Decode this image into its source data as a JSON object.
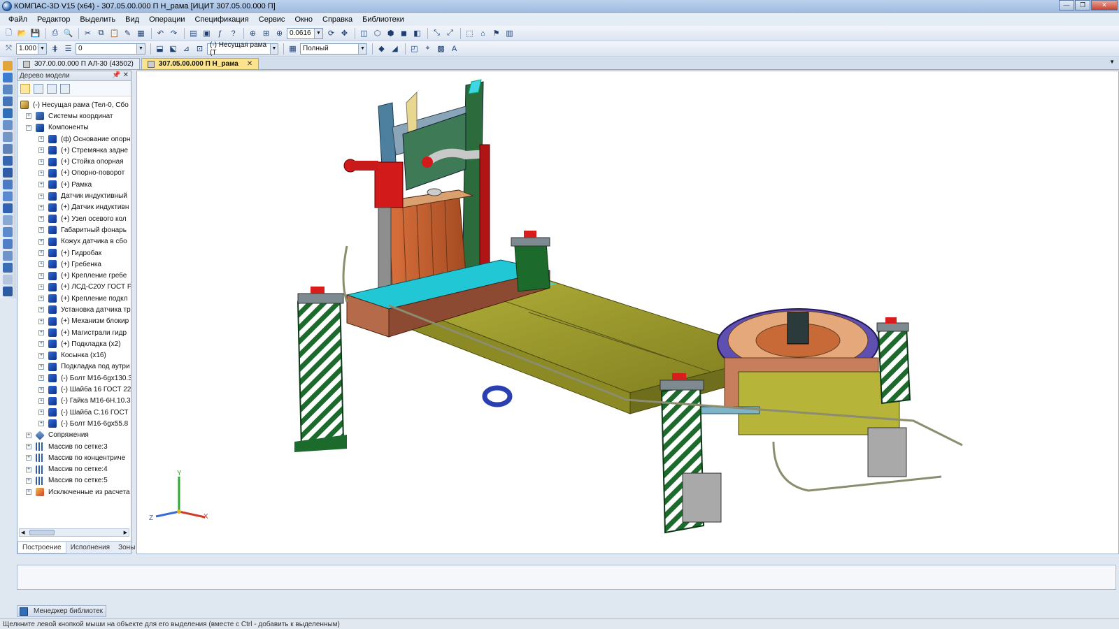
{
  "window": {
    "title": "КОМПАС-3D V15 (x64) - 307.05.00.000 П Н_рама [ИЦИТ 307.05.00.000 П]"
  },
  "menu": [
    "Файл",
    "Редактор",
    "Выделить",
    "Вид",
    "Операции",
    "Спецификация",
    "Сервис",
    "Окно",
    "Справка",
    "Библиотеки"
  ],
  "toolbar": {
    "zoom_value": "0.0616",
    "scale_value": "1.000",
    "layer_value": "0",
    "assembly_combo": "(-) Несущая рама (Т",
    "display_mode": "Полный"
  },
  "tabs": [
    {
      "label": "307.00.00.000 П АЛ-30 (43502)",
      "active": false
    },
    {
      "label": "307.05.00.000 П Н_рама",
      "active": true
    }
  ],
  "tree_panel": {
    "title": "Дерево модели",
    "root": "(-) Несущая рама (Тел-0, Сбо",
    "items": [
      {
        "label": "Системы координат",
        "icon": "coords",
        "level": 1
      },
      {
        "label": "Компоненты",
        "icon": "comp",
        "level": 1,
        "expanded": true
      },
      {
        "label": "(ф) Основание опорн",
        "icon": "part",
        "level": 2
      },
      {
        "label": "(+) Стремянка задне",
        "icon": "part",
        "level": 2
      },
      {
        "label": "(+) Стойка опорная",
        "icon": "part",
        "level": 2
      },
      {
        "label": "(+) Опорно-поворот",
        "icon": "part",
        "level": 2
      },
      {
        "label": "(+) Рамка",
        "icon": "part",
        "level": 2
      },
      {
        "label": "Датчик индуктивный",
        "icon": "part",
        "level": 2
      },
      {
        "label": "(+) Датчик индуктивн",
        "icon": "part",
        "level": 2
      },
      {
        "label": "(+) Узел осевого кол",
        "icon": "part",
        "level": 2
      },
      {
        "label": "Габаритный фонарь",
        "icon": "part",
        "level": 2
      },
      {
        "label": "Кожух датчика в сбо",
        "icon": "part",
        "level": 2
      },
      {
        "label": "(+) Гидробак",
        "icon": "part",
        "level": 2
      },
      {
        "label": "(+) Гребенка",
        "icon": "part",
        "level": 2
      },
      {
        "label": "(+) Крепление гребе",
        "icon": "part",
        "level": 2
      },
      {
        "label": "(+) ЛСД-С20У ГОСТ Р",
        "icon": "part",
        "level": 2
      },
      {
        "label": "(+) Крепление подкл",
        "icon": "part",
        "level": 2
      },
      {
        "label": "Установка датчика тр",
        "icon": "part",
        "level": 2
      },
      {
        "label": "(+) Механизм блокир",
        "icon": "part",
        "level": 2
      },
      {
        "label": "(+) Магистрали гидр",
        "icon": "part",
        "level": 2
      },
      {
        "label": "(+) Подкладка (x2)",
        "icon": "part",
        "level": 2
      },
      {
        "label": "Косынка (x16)",
        "icon": "part",
        "level": 2
      },
      {
        "label": "Подкладка под аутри",
        "icon": "part",
        "level": 2
      },
      {
        "label": "(-) Болт М16-6gx130.3",
        "icon": "part",
        "level": 2
      },
      {
        "label": "(-) Шайба 16 ГОСТ 22",
        "icon": "part",
        "level": 2
      },
      {
        "label": "(-) Гайка М16-6Н.10.3",
        "icon": "part",
        "level": 2
      },
      {
        "label": "(-) Шайба С.16 ГОСТ",
        "icon": "part",
        "level": 2
      },
      {
        "label": "(-) Болт М16-6gx55.8",
        "icon": "part",
        "level": 2
      },
      {
        "label": "Сопряжения",
        "icon": "link",
        "level": 1
      },
      {
        "label": "Массив по сетке:3",
        "icon": "grid",
        "level": 1
      },
      {
        "label": "Массив по концентриче",
        "icon": "grid",
        "level": 1
      },
      {
        "label": "Массив по сетке:4",
        "icon": "grid",
        "level": 1
      },
      {
        "label": "Массив по сетке:5",
        "icon": "grid",
        "level": 1
      },
      {
        "label": "Исключенные из расчета",
        "icon": "excl",
        "level": 1
      }
    ],
    "bottom_tabs": [
      "Построение",
      "Исполнения",
      "Зоны"
    ]
  },
  "viewport": {
    "axes": {
      "x": "X",
      "y": "Y",
      "z": "Z"
    }
  },
  "library_manager": "Менеджер библиотек",
  "status": "Щелкните левой кнопкой мыши на объекте для его выделения (вместе с Ctrl - добавить к выделенным)"
}
